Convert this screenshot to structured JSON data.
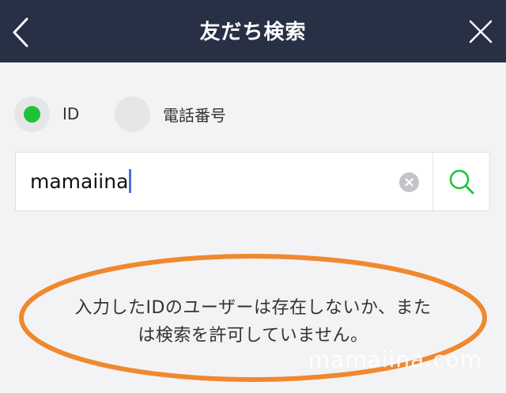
{
  "header": {
    "title": "友だち検索",
    "background_color": "#283046"
  },
  "search_type": {
    "options": [
      {
        "label": "ID",
        "selected": true
      },
      {
        "label": "電話番号",
        "selected": false
      }
    ],
    "selected_color": "#1ec337"
  },
  "search": {
    "value": "mamaiina"
  },
  "result": {
    "message_line1": "入力したIDのユーザーは存在しないか、また",
    "message_line2": "は検索を許可していません。"
  },
  "annotation": {
    "ellipse_color": "#f0882e"
  },
  "watermark": {
    "text": "mamaiina.com"
  }
}
